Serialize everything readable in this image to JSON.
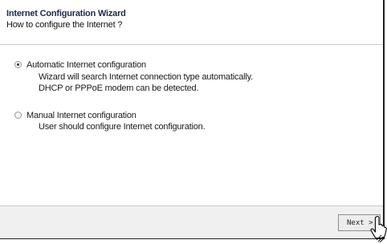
{
  "header": {
    "title": "Internet Configuration Wizard",
    "subtitle": "How to configure the Internet ?"
  },
  "options": [
    {
      "label": "Automatic Internet configuration",
      "selected": true,
      "description": [
        "Wizard will search Internet connection type automatically.",
        "DHCP or PPPoE modem can be detected."
      ]
    },
    {
      "label": "Manual Internet configuration",
      "selected": false,
      "description": [
        "User should configure Internet configuration."
      ]
    }
  ],
  "footer": {
    "next_label": "Next >"
  },
  "icons": {
    "cursor": "hand-pointer-icon"
  }
}
